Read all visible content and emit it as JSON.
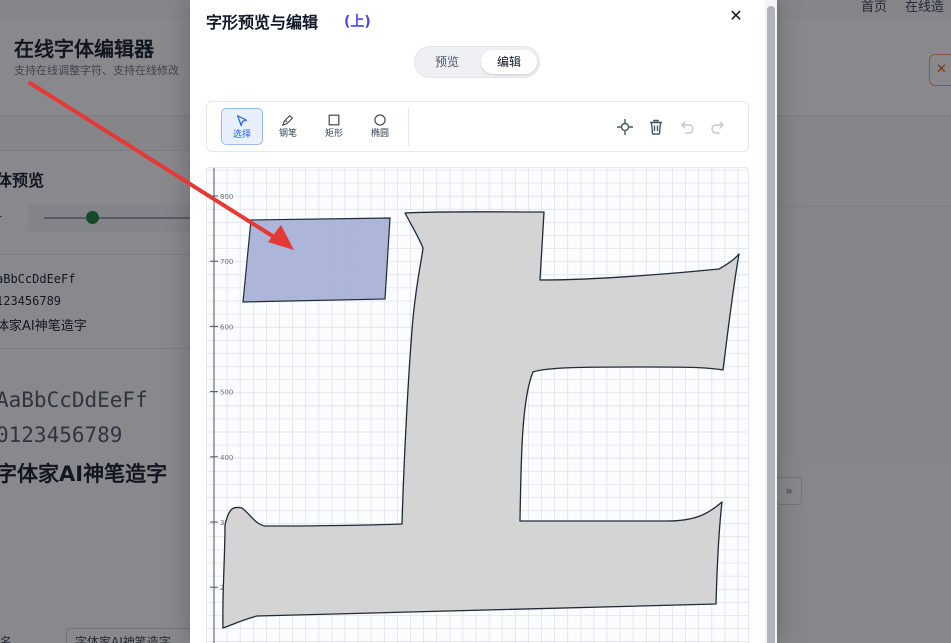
{
  "background": {
    "nav": {
      "home": "首页",
      "online": "在线造"
    },
    "app_title": "在线字体编辑器",
    "app_subtitle": "支持在线调整字符、支持在线修改",
    "header_button": "✕",
    "preview_title": "体预览",
    "slider_label": "-",
    "samples": {
      "mono_latin": "aBbCcDdEeFf",
      "mono_digits": "123456789",
      "mono_cjk": "体家AI神笔造字",
      "big_latin": "AaBbCcDdEeFf",
      "big_digits": "0123456789",
      "big_cjk": "字体家AI神笔造字"
    },
    "right_button": "»",
    "bottom_label": "名",
    "bottom_input": "字体家AI神笔造字"
  },
  "modal": {
    "title": "字形预览与编辑",
    "char_label": "(上)",
    "close_icon": "close-icon",
    "tabs": [
      {
        "label": "预览",
        "active": false
      },
      {
        "label": "编辑",
        "active": true
      }
    ],
    "tools": [
      {
        "id": "select",
        "label": "选择",
        "icon": "cursor-icon",
        "active": true
      },
      {
        "id": "pen",
        "label": "钢笔",
        "icon": "pen-icon",
        "active": false
      },
      {
        "id": "rect",
        "label": "矩形",
        "icon": "square-icon",
        "active": false
      },
      {
        "id": "ellipse",
        "label": "椭圆",
        "icon": "circle-icon",
        "active": false
      }
    ],
    "actions": [
      {
        "id": "add-point",
        "icon": "crosshair-icon"
      },
      {
        "id": "delete",
        "icon": "trash-icon"
      },
      {
        "id": "undo",
        "icon": "undo-icon"
      },
      {
        "id": "redo",
        "icon": "redo-icon"
      }
    ],
    "y_axis_labels": [
      "800",
      "700",
      "600",
      "500",
      "400",
      "300",
      "200"
    ],
    "colors": {
      "glyph_fill": "#d4d4d4",
      "glyph_stroke": "#1f2a3a",
      "selection_fill": "#a9b1d6",
      "grid": "#dde3ea",
      "accent": "#2563eb",
      "arrow": "#e53935"
    }
  }
}
